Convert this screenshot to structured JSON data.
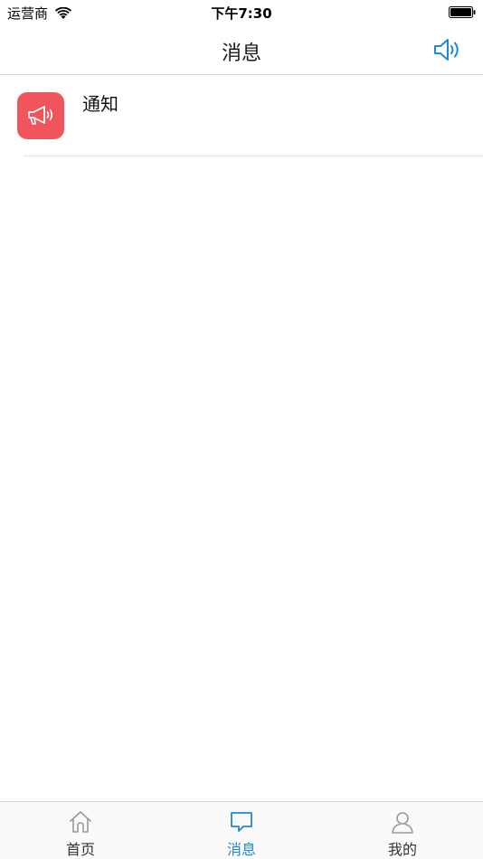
{
  "status_bar": {
    "carrier": "运营商",
    "time": "下午7:30"
  },
  "nav": {
    "title": "消息",
    "right_icon": "speaker-icon"
  },
  "messages": [
    {
      "title": "通知",
      "icon": "megaphone-icon",
      "icon_color": "#f0545c"
    }
  ],
  "tabs": [
    {
      "label": "首页",
      "icon": "home-icon",
      "active": false
    },
    {
      "label": "消息",
      "icon": "chat-bubble-icon",
      "active": true
    },
    {
      "label": "我的",
      "icon": "person-icon",
      "active": false
    }
  ],
  "colors": {
    "accent": "#1e88d8",
    "inactive": "#999999"
  }
}
